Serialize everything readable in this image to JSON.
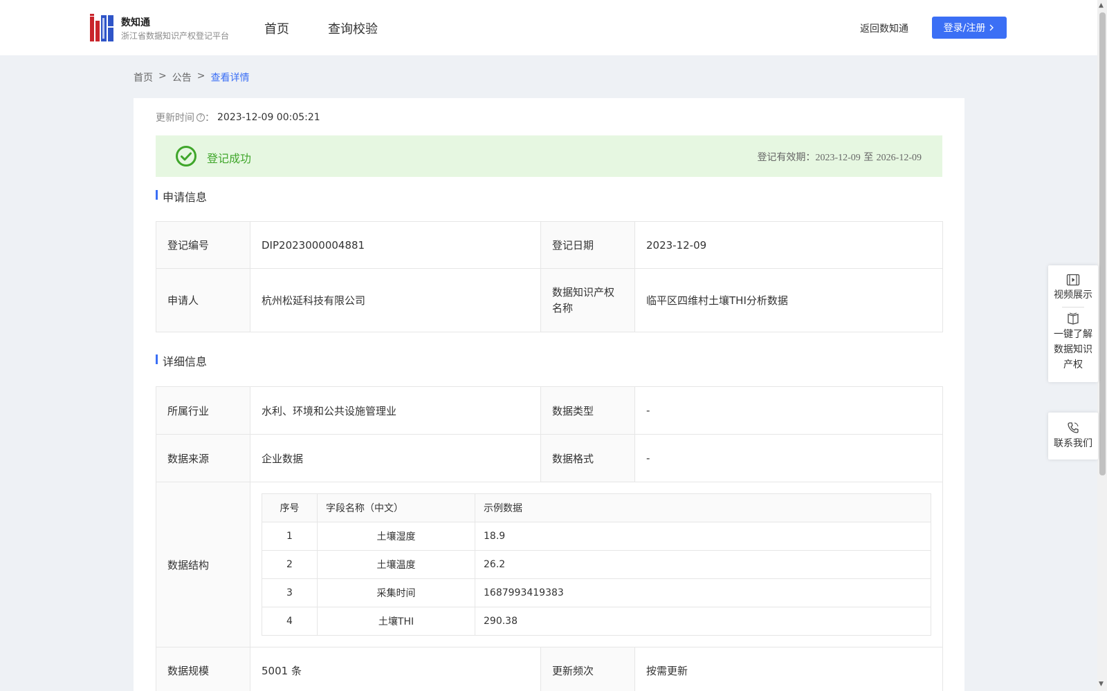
{
  "header": {
    "brand_name": "数知通",
    "brand_sub": "浙江省数据知识产权登记平台",
    "nav": [
      "首页",
      "查询校验"
    ],
    "back_link": "返回数知通",
    "login_button": "登录/注册",
    "accent_color": "#3b6ff5"
  },
  "breadcrumb": {
    "items": [
      "首页",
      "公告",
      "查看详情"
    ],
    "separator": ">"
  },
  "update": {
    "label": "更新时间",
    "value": "2023-12-09 00:05:21"
  },
  "status": {
    "text": "登记成功",
    "validity_label": "登记有效期：",
    "validity_start": "2023-12-09",
    "validity_to": "至",
    "validity_end": "2026-12-09",
    "color": "#3fa62a"
  },
  "application": {
    "title": "申请信息",
    "reg_no_label": "登记编号",
    "reg_no": "DIP2023000004881",
    "reg_date_label": "登记日期",
    "reg_date": "2023-12-09",
    "applicant_label": "申请人",
    "applicant": "杭州松延科技有限公司",
    "ip_name_label": "数据知识产权名称",
    "ip_name": "临平区四维村土壤THI分析数据"
  },
  "details": {
    "title": "详细信息",
    "industry_label": "所属行业",
    "industry": "水利、环境和公共设施管理业",
    "data_type_label": "数据类型",
    "data_type": "-",
    "source_label": "数据来源",
    "source": "企业数据",
    "format_label": "数据格式",
    "format": "-",
    "structure_label": "数据结构",
    "structure": {
      "headers": [
        "序号",
        "字段名称（中文）",
        "示例数据"
      ],
      "rows": [
        [
          "1",
          "土壤湿度",
          "18.9"
        ],
        [
          "2",
          "土壤温度",
          "26.2"
        ],
        [
          "3",
          "采集时间",
          "1687993419383"
        ],
        [
          "4",
          "土壤THI",
          "290.38"
        ]
      ]
    },
    "scale_label": "数据规模",
    "scale": "5001 条",
    "frequency_label": "更新频次",
    "frequency": "按需更新"
  },
  "side_panel": {
    "video": "视频展示",
    "learn": "一键了解数据知识产权",
    "contact": "联系我们"
  }
}
